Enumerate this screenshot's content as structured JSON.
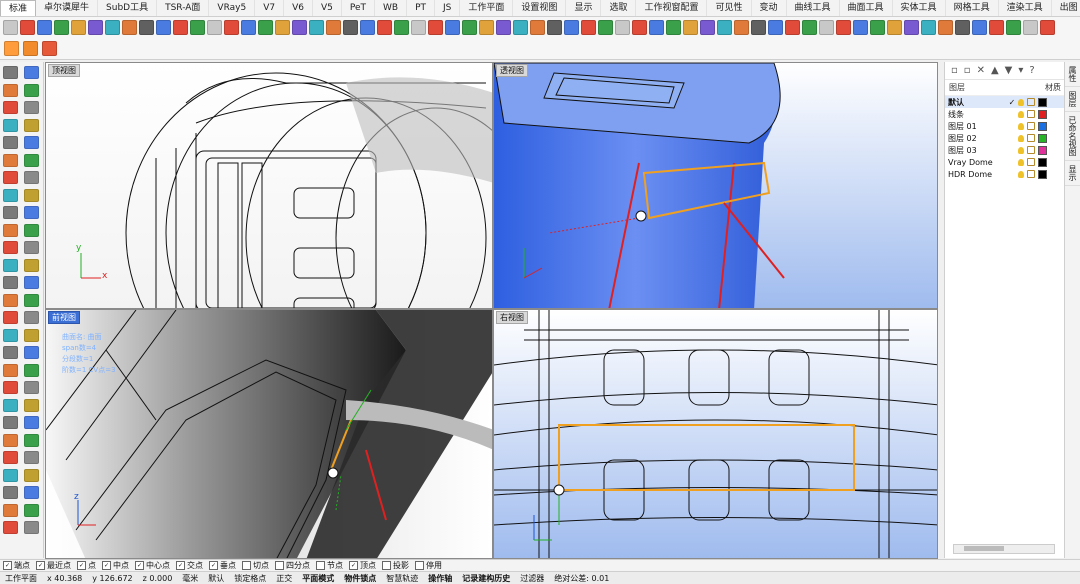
{
  "tabs": [
    "标准",
    "卓尔谟犀牛",
    "SubD工具",
    "TSR-A面",
    "VRay5",
    "V7",
    "V6",
    "V5",
    "PeT",
    "WB",
    "PT",
    "JS",
    "工作平面",
    "设置视图",
    "显示",
    "选取",
    "工作视窗配置",
    "可见性",
    "变动",
    "曲线工具",
    "曲面工具",
    "实体工具",
    "网格工具",
    "渲染工具",
    "出图"
  ],
  "viewports": {
    "top": {
      "label": "顶视图"
    },
    "perspective": {
      "label": "透视图"
    },
    "front": {
      "label": "前视图"
    },
    "right": {
      "label": "右视图"
    }
  },
  "front_info": {
    "line1": "曲面名: 曲面",
    "line2": "span数=4",
    "line3": "分段数=1",
    "line4": "阶数=1 CV点=3"
  },
  "axes": {
    "x": "x",
    "y": "y",
    "z": "z"
  },
  "layers_panel": {
    "header_name": "图层",
    "header_material": "材质",
    "rows": [
      {
        "name": "默认",
        "checked": true,
        "color": "#000000"
      },
      {
        "name": "线条",
        "color": "#e02020"
      },
      {
        "name": "图层 01",
        "color": "#1b6fe0"
      },
      {
        "name": "图层 02",
        "color": "#28b428"
      },
      {
        "name": "图层 03",
        "color": "#e0309a"
      },
      {
        "name": "Vray Dome",
        "color": "#000000"
      },
      {
        "name": "HDR Dome",
        "color": "#000000"
      }
    ],
    "check_mark": "✓"
  },
  "right_tabs": [
    "属性",
    "图层",
    "已命名视图",
    "显示"
  ],
  "osnaps": [
    {
      "label": "端点",
      "checked": true
    },
    {
      "label": "最近点",
      "checked": true
    },
    {
      "label": "点",
      "checked": true
    },
    {
      "label": "中点",
      "checked": true
    },
    {
      "label": "中心点",
      "checked": true
    },
    {
      "label": "交点",
      "checked": true
    },
    {
      "label": "垂点",
      "checked": true
    },
    {
      "label": "切点",
      "checked": false
    },
    {
      "label": "四分点",
      "checked": false
    },
    {
      "label": "节点",
      "checked": false
    },
    {
      "label": "顶点",
      "checked": true
    },
    {
      "label": "投影",
      "checked": false
    },
    {
      "label": "停用",
      "checked": false
    }
  ],
  "status": {
    "cplane": "工作平面",
    "x": "x 40.368",
    "y": "y 126.672",
    "z": "z 0.000",
    "units": "毫米",
    "layer": "默认",
    "grid_snap": "锁定格点",
    "ortho": "正交",
    "planar": "平面模式",
    "osnap": "物件锁点",
    "smarttrack": "智慧轨迹",
    "gumball": "操作轴",
    "history": "记录建构历史",
    "filter": "过滤器",
    "tolerance": "绝对公差: 0.01"
  }
}
